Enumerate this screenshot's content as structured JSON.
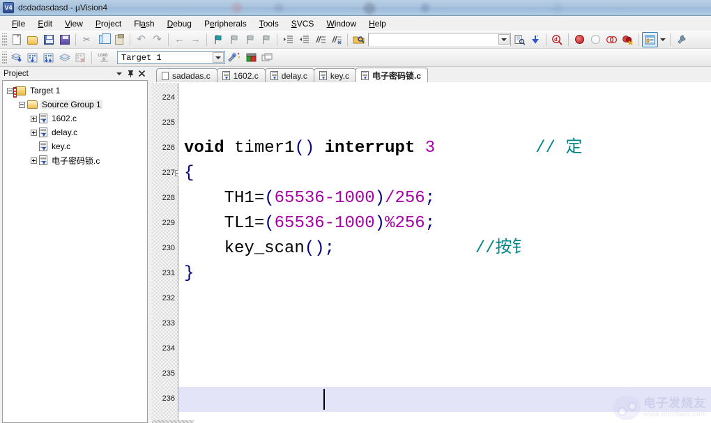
{
  "window": {
    "title": "dsdadasdasd  - µVision4",
    "app_icon": "uvision-logo-icon"
  },
  "menu": {
    "items": [
      "File",
      "Edit",
      "View",
      "Project",
      "Flash",
      "Debug",
      "Peripherals",
      "Tools",
      "SVCS",
      "Window",
      "Help"
    ]
  },
  "toolbar_main": {
    "buttons": [
      "new-file-icon",
      "open-file-icon",
      "save-icon",
      "save-all-icon",
      "cut-icon",
      "copy-icon",
      "paste-icon",
      "undo-icon",
      "redo-icon",
      "navigate-back-icon",
      "navigate-forward-icon",
      "insert-bookmark-icon",
      "next-bookmark-icon",
      "previous-bookmark-icon",
      "clear-bookmarks-icon",
      "indent-icon",
      "outdent-icon",
      "comment-icon",
      "uncomment-icon",
      "find-in-files-icon"
    ],
    "find_value": "",
    "find_placeholder": "",
    "buttons_right": [
      "bookmark-list-icon",
      "find-next-icon",
      "start-debug-icon",
      "insert-breakpoint-icon",
      "disable-breakpoint-icon",
      "disable-all-breakpoints-icon",
      "kill-all-breakpoints-icon",
      "project-window-icon",
      "configuration-wizard-icon"
    ]
  },
  "toolbar_build": {
    "buttons": [
      "translate-file-icon",
      "build-target-icon",
      "rebuild-all-icon",
      "batch-build-icon",
      "stop-build-icon",
      "download-icon"
    ],
    "target_value": "Target 1",
    "buttons_after": [
      "options-for-target-icon",
      "manage-components-icon",
      "manage-multi-project-icon"
    ]
  },
  "project_panel": {
    "title": "Project",
    "header_buttons": [
      "dropdown-menu-icon",
      "auto-hide-pin-icon",
      "close-panel-icon"
    ],
    "tree": [
      {
        "label": "Target 1",
        "level": 0,
        "icon": "target-icon",
        "expander": "minus",
        "selected": false
      },
      {
        "label": "Source Group 1",
        "level": 1,
        "icon": "folder-group-icon",
        "expander": "minus",
        "selected": true
      },
      {
        "label": "1602.c",
        "level": 2,
        "icon": "c-file-icon",
        "expander": "plus",
        "selected": false
      },
      {
        "label": "delay.c",
        "level": 2,
        "icon": "c-file-icon",
        "expander": "plus",
        "selected": false
      },
      {
        "label": "key.c",
        "level": 2,
        "icon": "c-file-icon",
        "expander": "none",
        "selected": false
      },
      {
        "label": "电子密码锁.c",
        "level": 2,
        "icon": "c-file-icon",
        "expander": "plus",
        "selected": false
      }
    ]
  },
  "editor": {
    "tabs": [
      {
        "label": "sadadas.c",
        "icon": "plain-file-icon",
        "active": false
      },
      {
        "label": "1602.c",
        "icon": "c-file-icon",
        "active": false
      },
      {
        "label": "delay.c",
        "icon": "c-file-icon",
        "active": false
      },
      {
        "label": "key.c",
        "icon": "c-file-icon",
        "active": false
      },
      {
        "label": "电子密码锁.c",
        "icon": "c-file-icon",
        "active": true
      }
    ],
    "first_visible_line": 224,
    "cursor_line": 236,
    "lines": [
      {
        "n": 224,
        "fold": "none",
        "tokens": []
      },
      {
        "n": 225,
        "fold": "end",
        "tokens": []
      },
      {
        "n": 226,
        "fold": "none",
        "tokens": [
          {
            "t": "void",
            "c": "kw"
          },
          {
            "t": " ",
            "c": "id"
          },
          {
            "t": "timer1",
            "c": "id"
          },
          {
            "t": "()",
            "c": "punc"
          },
          {
            "t": " ",
            "c": "id"
          },
          {
            "t": "interrupt",
            "c": "kw"
          },
          {
            "t": " ",
            "c": "id"
          },
          {
            "t": "3",
            "c": "num2"
          },
          {
            "t": "          ",
            "c": "id"
          },
          {
            "t": "// 定",
            "c": "cmt"
          }
        ]
      },
      {
        "n": 227,
        "fold": "start",
        "tokens": [
          {
            "t": "{",
            "c": "punc"
          }
        ]
      },
      {
        "n": 228,
        "fold": "bar",
        "tokens": [
          {
            "t": "    ",
            "c": "id"
          },
          {
            "t": "TH1",
            "c": "id"
          },
          {
            "t": "=",
            "c": "id"
          },
          {
            "t": "(",
            "c": "punc"
          },
          {
            "t": "65536",
            "c": "num2"
          },
          {
            "t": "-",
            "c": "op"
          },
          {
            "t": "1000",
            "c": "num2"
          },
          {
            "t": ")",
            "c": "punc"
          },
          {
            "t": "/",
            "c": "op"
          },
          {
            "t": "256",
            "c": "num2"
          },
          {
            "t": ";",
            "c": "punc"
          }
        ]
      },
      {
        "n": 229,
        "fold": "bar",
        "tokens": [
          {
            "t": "    ",
            "c": "id"
          },
          {
            "t": "TL1",
            "c": "id"
          },
          {
            "t": "=",
            "c": "id"
          },
          {
            "t": "(",
            "c": "punc"
          },
          {
            "t": "65536",
            "c": "num2"
          },
          {
            "t": "-",
            "c": "op"
          },
          {
            "t": "1000",
            "c": "num2"
          },
          {
            "t": ")",
            "c": "punc"
          },
          {
            "t": "%",
            "c": "op"
          },
          {
            "t": "256",
            "c": "num2"
          },
          {
            "t": ";",
            "c": "punc"
          }
        ]
      },
      {
        "n": 230,
        "fold": "bar",
        "tokens": [
          {
            "t": "    ",
            "c": "id"
          },
          {
            "t": "key_scan",
            "c": "id"
          },
          {
            "t": "()",
            "c": "punc"
          },
          {
            "t": ";",
            "c": "punc"
          },
          {
            "t": "              ",
            "c": "id"
          },
          {
            "t": "//按钅",
            "c": "cmt"
          }
        ]
      },
      {
        "n": 231,
        "fold": "endb",
        "tokens": [
          {
            "t": "}",
            "c": "punc"
          }
        ]
      },
      {
        "n": 232,
        "fold": "none",
        "tokens": []
      },
      {
        "n": 233,
        "fold": "none",
        "tokens": []
      },
      {
        "n": 234,
        "fold": "none",
        "tokens": []
      },
      {
        "n": 235,
        "fold": "none",
        "tokens": []
      },
      {
        "n": 236,
        "fold": "none",
        "tokens": []
      }
    ]
  },
  "watermark": {
    "cn": "电子发烧友",
    "en": "www.elecfans.com"
  },
  "colors": {
    "keyword": "#000000",
    "number": "#a800a8",
    "punctuation": "#000080",
    "comment": "#008486",
    "current_line": "#e4e4f8",
    "gutter": "#d8d8d8",
    "titlebar": "#a9c4dd"
  }
}
